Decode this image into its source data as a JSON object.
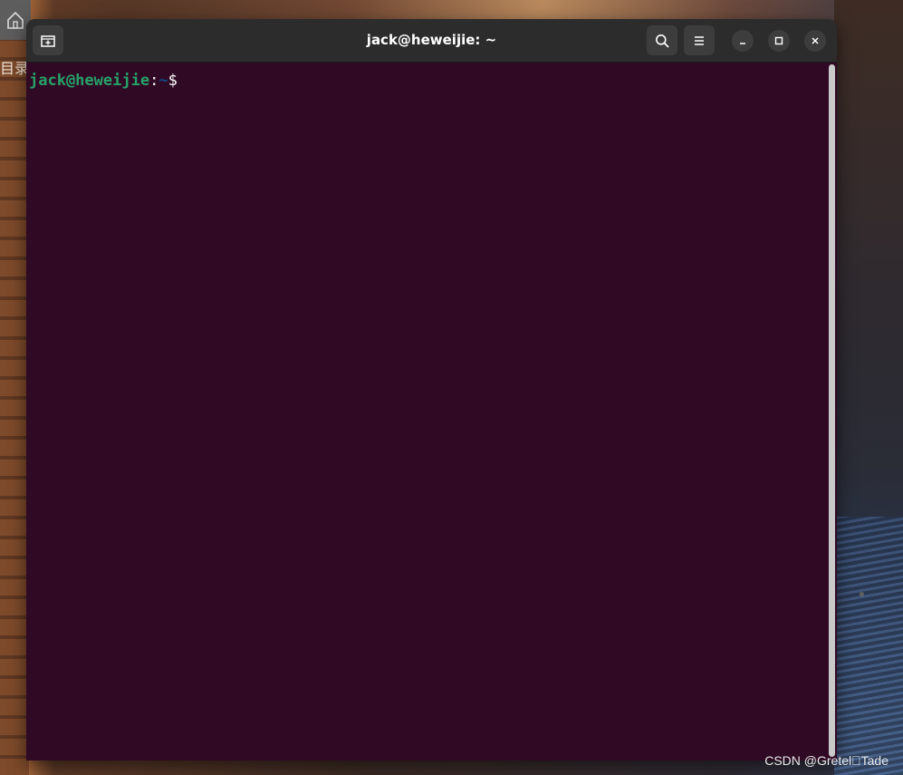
{
  "desktop": {
    "side_label": "目录",
    "watermark": "CSDN @Gretel\u0000Tade",
    "home_icon": "home-icon"
  },
  "window": {
    "title": "jack@heweijie: ~",
    "buttons": {
      "new_tab": "new-tab-icon",
      "search": "search-icon",
      "menu": "hamburger-menu-icon",
      "minimize": "minimize-icon",
      "maximize": "maximize-icon",
      "close": "close-icon"
    }
  },
  "terminal": {
    "prompt": {
      "user_host": "jack@heweijie",
      "separator": ":",
      "directory": "~",
      "symbol": "$"
    }
  },
  "colors": {
    "terminal_bg": "#300a24",
    "titlebar_bg": "#2c2c2c",
    "prompt_user": "#26a269",
    "prompt_dir": "#12488b"
  }
}
